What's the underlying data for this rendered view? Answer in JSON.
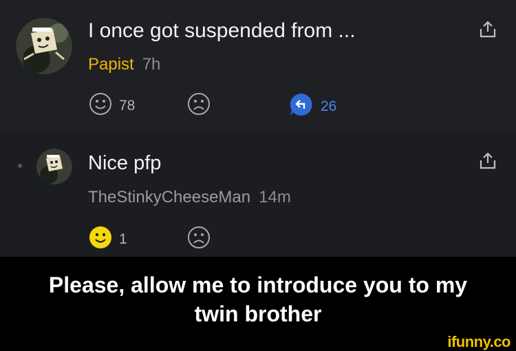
{
  "comments": [
    {
      "text": "I once got suspended from ...",
      "username": "Papist",
      "time": "7h",
      "smile_count": "78",
      "reply_count": "26"
    },
    {
      "text": "Nice pfp",
      "username": "TheStinkyCheeseMan",
      "time": "14m",
      "smile_count": "1"
    }
  ],
  "caption": {
    "line1": "Please, allow me to introduce you to my",
    "line2": "twin brother"
  },
  "watermark": "ifunny.co",
  "colors": {
    "username_highlight": "#f0b400",
    "reply_blue": "#2e6bd6",
    "smile_active": "#f5d90a"
  }
}
